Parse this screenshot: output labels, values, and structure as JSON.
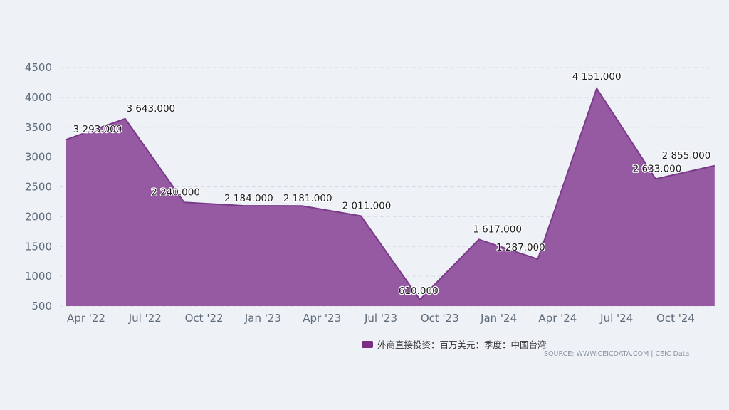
{
  "colors": {
    "area_fill": "#8e4d9b",
    "area_stroke": "#7a3a8a",
    "legend_swatch": "#7b2d84",
    "background": "#eef2f7"
  },
  "legend": {
    "label": "外商直接投资：百万美元：季度：中国台湾"
  },
  "source": "SOURCE: WWW.CEICDATA.COM | CEIC Data",
  "chart_data": {
    "type": "area",
    "x": [
      "2022-04",
      "2022-07",
      "2022-10",
      "2023-01",
      "2023-04",
      "2023-07",
      "2023-10",
      "2024-01",
      "2024-04",
      "2024-07",
      "2024-10",
      "2024-12"
    ],
    "series": [
      {
        "name": "外商直接投资：百万美元：季度：中国台湾",
        "values": [
          3293,
          3643,
          2240,
          2184,
          2181,
          2011,
          610,
          1617,
          1287,
          4151,
          2633,
          2855
        ],
        "labels": [
          "3 293.000",
          "3 643.000",
          "2 240.000",
          "2 184.000",
          "2 181.000",
          "2 011.000",
          "610.000",
          "1 617.000",
          "1 287.000",
          "4 151.000",
          "2 633.000",
          "2 855.000"
        ]
      }
    ],
    "x_tick_labels": [
      "Apr '22",
      "Jul '22",
      "Oct '22",
      "Jan '23",
      "Apr '23",
      "Jul '23",
      "Oct '23",
      "Jan '24",
      "Apr '24",
      "Jul '24",
      "Oct '24"
    ],
    "y_ticks": [
      "500",
      "1000",
      "1500",
      "2000",
      "2500",
      "3000",
      "3500",
      "4000",
      "4500"
    ],
    "ylim": [
      500,
      4500
    ],
    "grid": true,
    "legend_position": "bottom-right",
    "xlabel": "",
    "ylabel": ""
  }
}
